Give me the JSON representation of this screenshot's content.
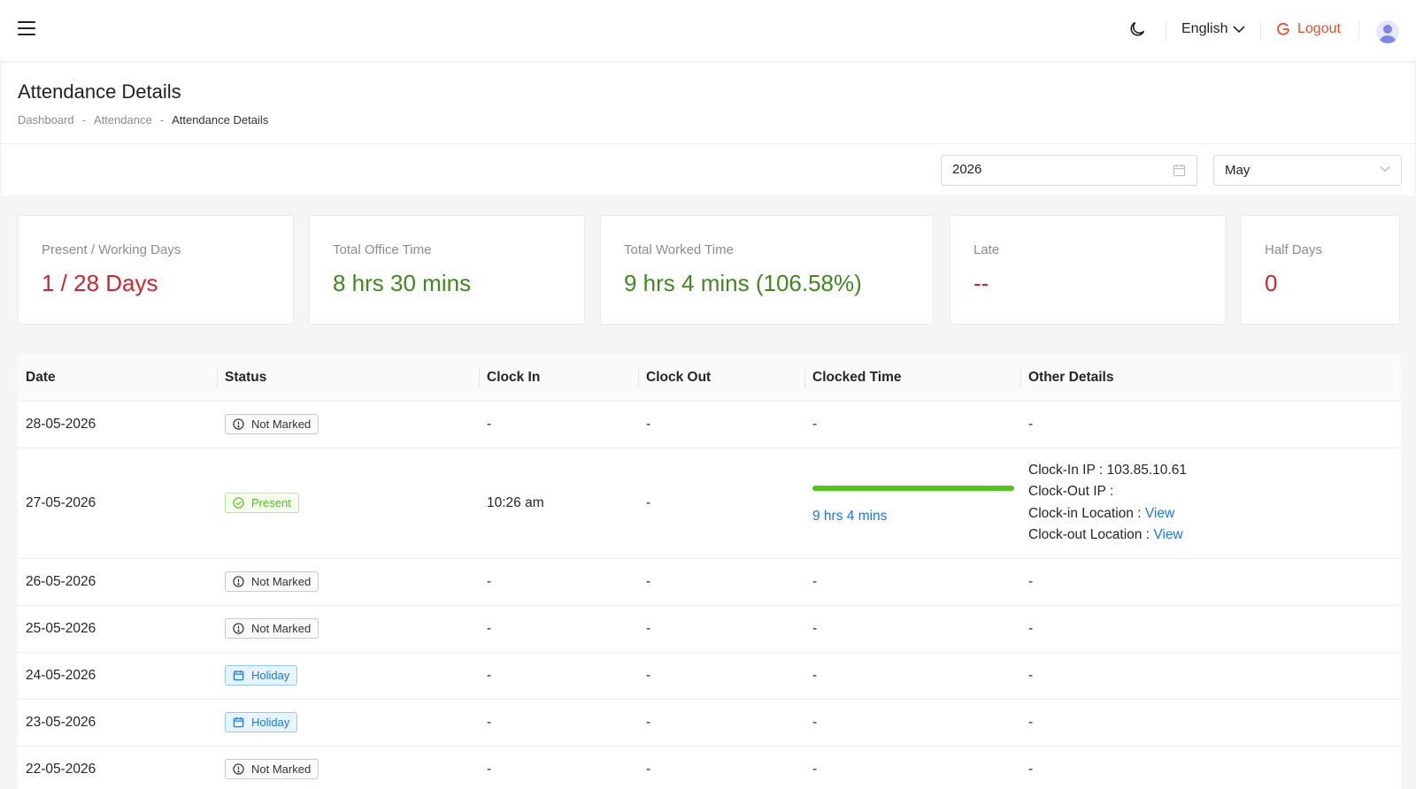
{
  "header": {
    "language": "English",
    "logout_label": "Logout"
  },
  "page": {
    "title": "Attendance Details",
    "breadcrumb": [
      "Dashboard",
      "Attendance",
      "Attendance Details"
    ],
    "breadcrumb_sep": "-"
  },
  "filters": {
    "year": "2026",
    "month": "May"
  },
  "stats": [
    {
      "label": "Present / Working Days",
      "value": "1 / 28 Days",
      "color": "#d4232d"
    },
    {
      "label": "Total Office Time",
      "value": "8 hrs 30 mins",
      "color": "#3f8a1c"
    },
    {
      "label": "Total Worked Time",
      "value": "9 hrs 4 mins (106.58%)",
      "color": "#3f8a1c"
    },
    {
      "label": "Late",
      "value": "--",
      "color": "#d4232d"
    },
    {
      "label": "Half Days",
      "value": "0",
      "color": "#d4232d"
    }
  ],
  "table": {
    "columns": [
      "Date",
      "Status",
      "Clock In",
      "Clock Out",
      "Clocked Time",
      "Other Details"
    ],
    "rows": [
      {
        "date": "28-05-2026",
        "status": "Not Marked",
        "clock_in": "-",
        "clock_out": "-",
        "clocked": "-",
        "other": "-"
      },
      {
        "date": "27-05-2026",
        "status": "Present",
        "clock_in": "10:26 am",
        "clock_out": "-",
        "clocked": "9 hrs 4 mins",
        "clocked_progress": 1.0,
        "details": {
          "clock_in_ip_label": "Clock-In IP :",
          "clock_in_ip": "103.85.10.61",
          "clock_out_ip_label": "Clock-Out IP :",
          "clock_in_location_label": "Clock-in Location :",
          "clock_out_location_label": "Clock-out Location :",
          "view_label": "View"
        }
      },
      {
        "date": "26-05-2026",
        "status": "Not Marked",
        "clock_in": "-",
        "clock_out": "-",
        "clocked": "-",
        "other": "-"
      },
      {
        "date": "25-05-2026",
        "status": "Not Marked",
        "clock_in": "-",
        "clock_out": "-",
        "clocked": "-",
        "other": "-"
      },
      {
        "date": "24-05-2026",
        "status": "Holiday",
        "clock_in": "-",
        "clock_out": "-",
        "clocked": "-",
        "other": "-"
      },
      {
        "date": "23-05-2026",
        "status": "Holiday",
        "clock_in": "-",
        "clock_out": "-",
        "clocked": "-",
        "other": "-"
      },
      {
        "date": "22-05-2026",
        "status": "Not Marked",
        "clock_in": "-",
        "clock_out": "-",
        "clocked": "-",
        "other": "-"
      }
    ]
  },
  "icons": {
    "menu": "menu-icon",
    "theme": "moon-icon",
    "logout": "logout-icon",
    "user": "user-avatar-icon",
    "calendar": "calendar-icon",
    "not_marked": "exclamation-circle-icon",
    "present": "check-circle-icon",
    "holiday": "calendar-icon"
  }
}
